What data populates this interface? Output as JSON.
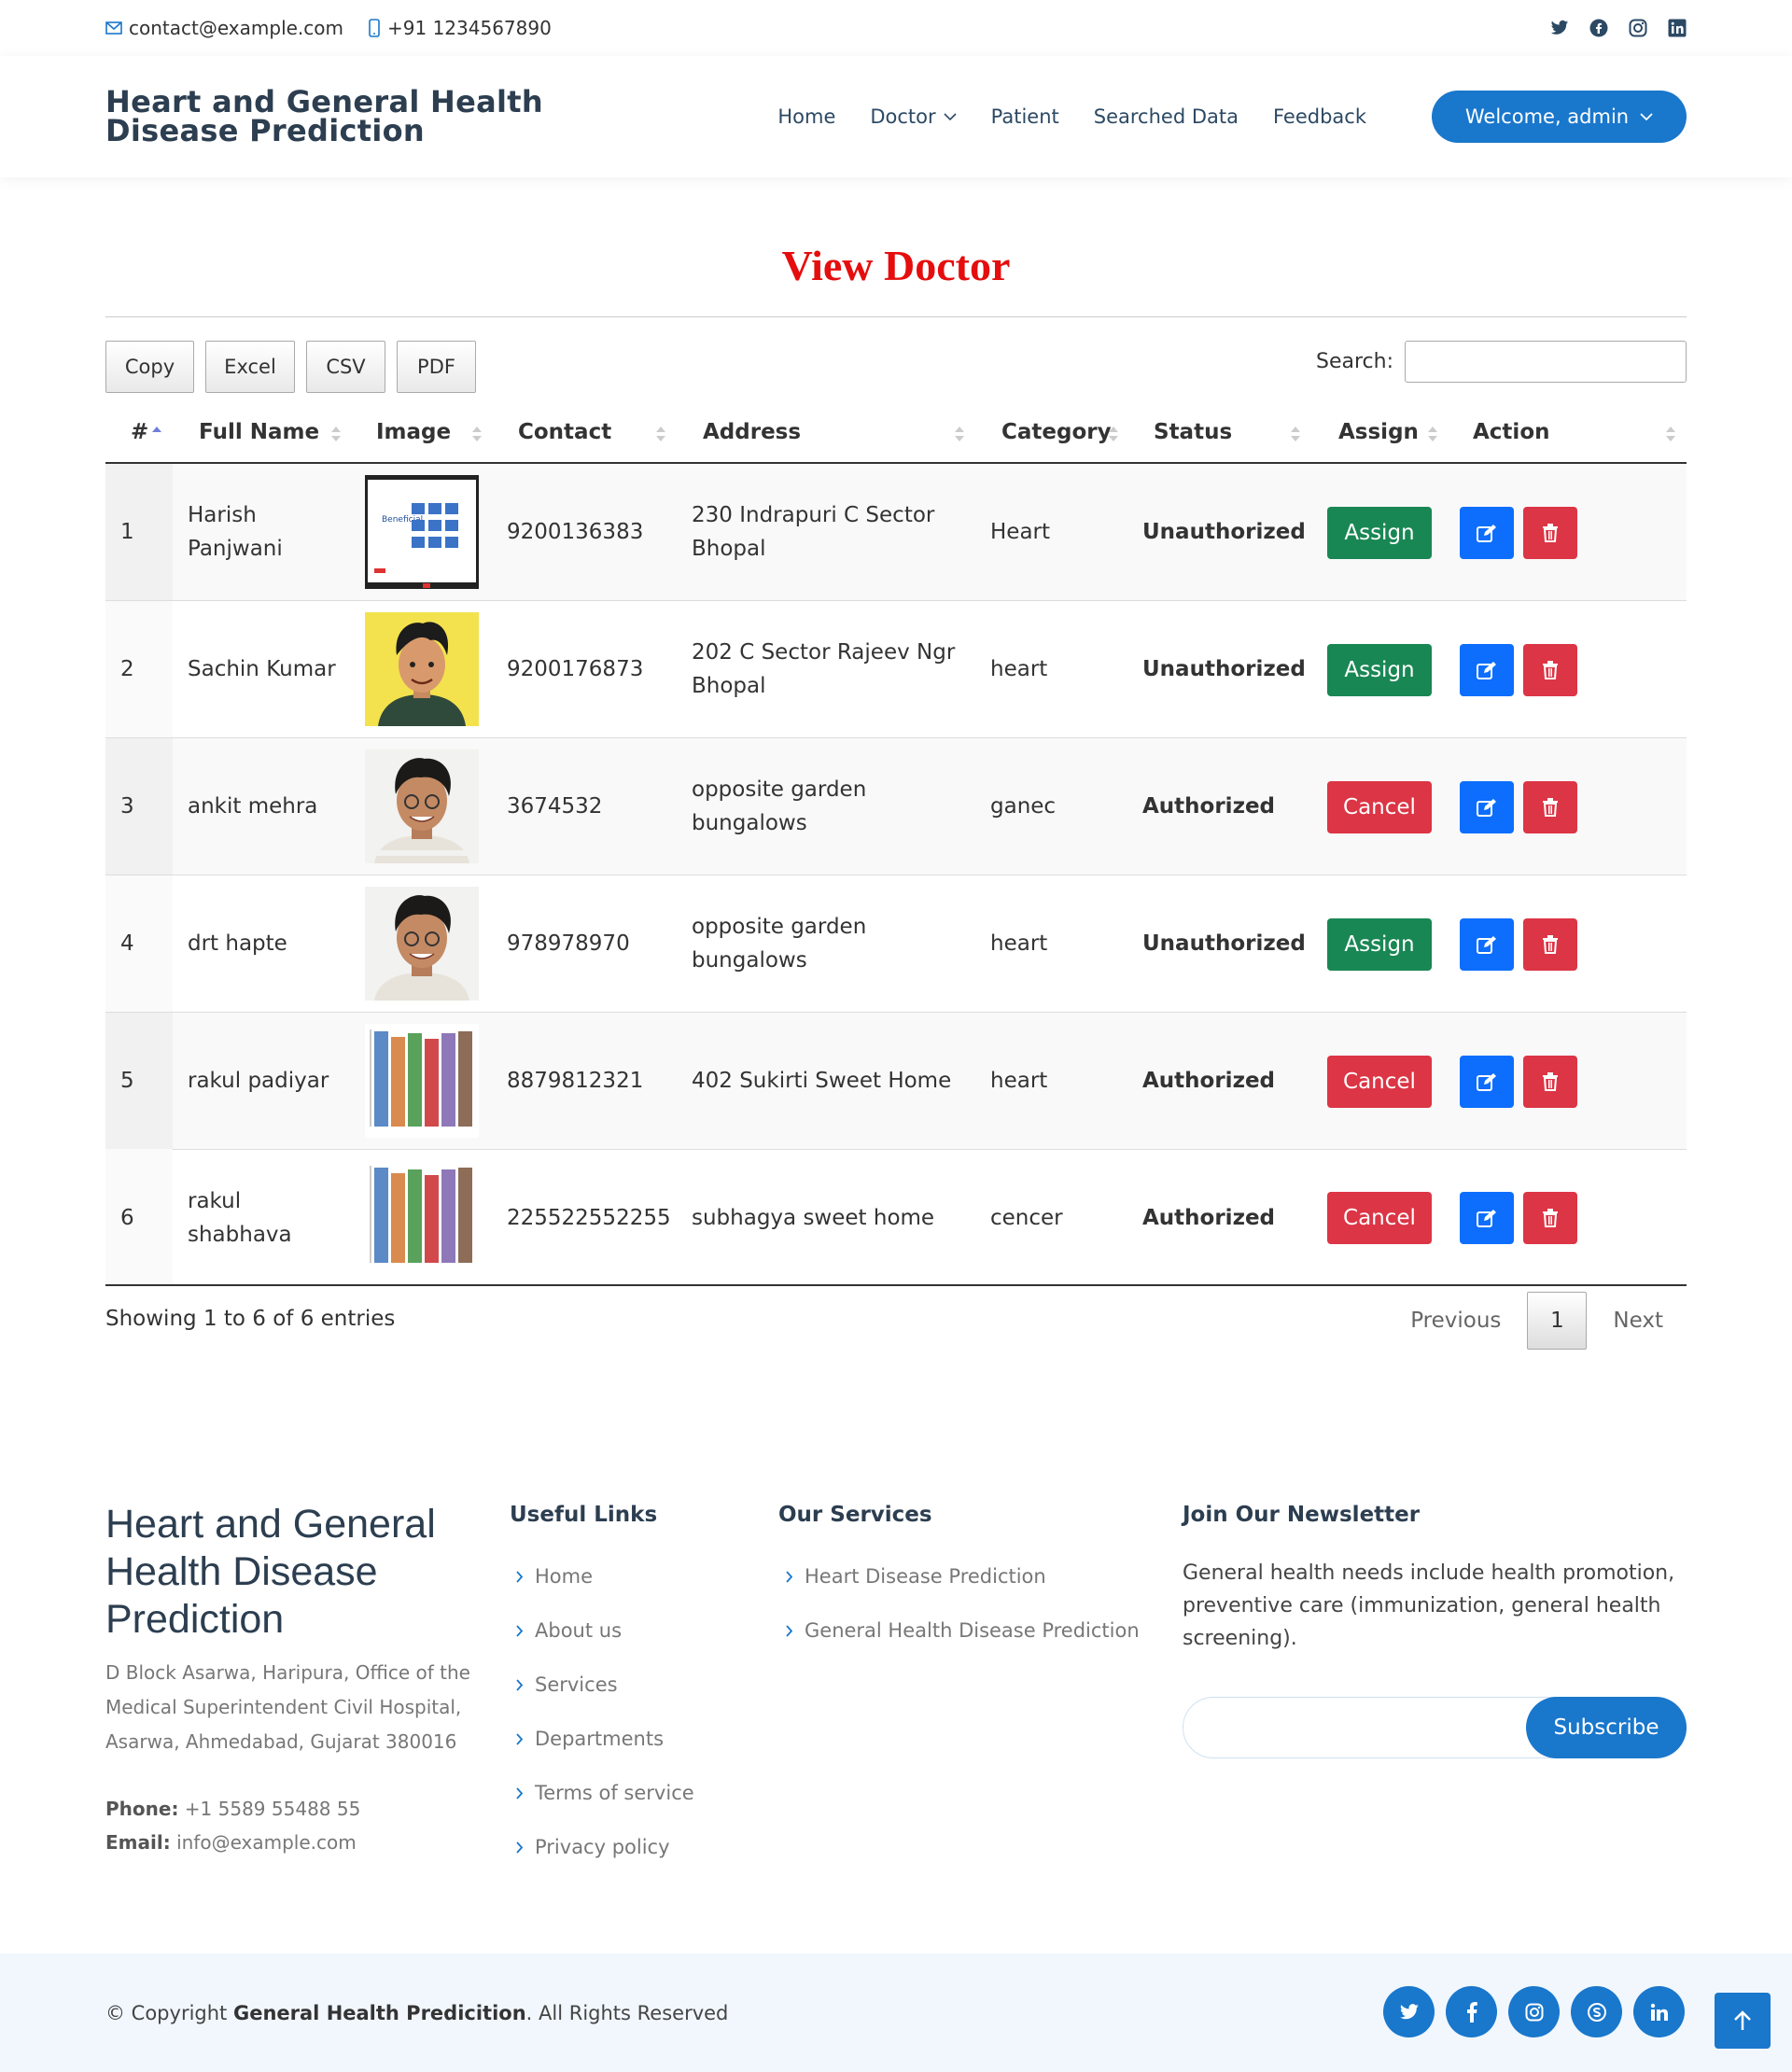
{
  "topbar": {
    "email": "contact@example.com",
    "phone": "+91 1234567890",
    "social_icons": [
      "twitter-icon",
      "facebook-icon",
      "instagram-icon",
      "linkedin-icon"
    ]
  },
  "header": {
    "logo": "Heart and General Health Disease Prediction",
    "nav": [
      "Home",
      "Doctor",
      "Patient",
      "Searched Data",
      "Feedback"
    ],
    "user_button": "Welcome, admin"
  },
  "page": {
    "title": "View Doctor"
  },
  "toolbar": {
    "buttons": [
      "Copy",
      "Excel",
      "CSV",
      "PDF"
    ],
    "search_label": "Search:",
    "search_value": ""
  },
  "table": {
    "columns": [
      "#",
      "Full Name",
      "Image",
      "Contact",
      "Address",
      "Category",
      "Status",
      "Assign",
      "Action"
    ],
    "rows": [
      {
        "no": "1",
        "name": "Harish Panjwani",
        "image": "document-thumbnail",
        "contact": "9200136383",
        "address": "230 Indrapuri C Sector Bhopal",
        "category": "Heart",
        "status": "Unauthorized",
        "assign": "Assign"
      },
      {
        "no": "2",
        "name": "Sachin Kumar",
        "image": "cartoon-avatar",
        "contact": "9200176873",
        "address": "202 C Sector Rajeev Ngr Bhopal",
        "category": "heart",
        "status": "Unauthorized",
        "assign": "Assign"
      },
      {
        "no": "3",
        "name": "ankit mehra",
        "image": "person-photo",
        "contact": "3674532",
        "address": "opposite garden bungalows",
        "category": "ganec",
        "status": "Authorized",
        "assign": "Cancel"
      },
      {
        "no": "4",
        "name": "drt hapte",
        "image": "person-photo",
        "contact": "978978970",
        "address": "opposite garden bungalows",
        "category": "heart",
        "status": "Unauthorized",
        "assign": "Assign"
      },
      {
        "no": "5",
        "name": "rakul padiyar",
        "image": "bar-chart-thumbnail",
        "contact": "8879812321",
        "address": "402 Sukirti Sweet Home",
        "category": "heart",
        "status": "Authorized",
        "assign": "Cancel"
      },
      {
        "no": "6",
        "name": "rakul shabhava",
        "image": "bar-chart-thumbnail",
        "contact": "225522552255",
        "address": "subhagya sweet home",
        "category": "cencer",
        "status": "Authorized",
        "assign": "Cancel"
      }
    ],
    "info": "Showing 1 to 6 of 6 entries",
    "pagination": {
      "previous": "Previous",
      "current": "1",
      "next": "Next"
    }
  },
  "footer": {
    "title": "Heart and General Health Disease Prediction",
    "address": "D Block Asarwa, Haripura, Office of the Medical Superintendent Civil Hospital, Asarwa, Ahmedabad, Gujarat 380016",
    "phone_label": "Phone:",
    "phone": "+1 5589 55488 55",
    "email_label": "Email:",
    "email": "info@example.com",
    "useful_links_title": "Useful Links",
    "useful_links": [
      "Home",
      "About us",
      "Services",
      "Departments",
      "Terms of service",
      "Privacy policy"
    ],
    "services_title": "Our Services",
    "services": [
      "Heart Disease Prediction",
      "General Health Disease Prediction"
    ],
    "newsletter_title": "Join Our Newsletter",
    "newsletter_text": "General health needs include health promotion, preventive care (immunization, general health screening).",
    "subscribe": "Subscribe",
    "copyright_prefix": "© Copyright",
    "copyright_brand": "General Health Predicition",
    "copyright_suffix": ". All Rights Reserved",
    "social_icons": [
      "twitter-icon",
      "facebook-icon",
      "instagram-icon",
      "skype-icon",
      "linkedin-icon"
    ]
  },
  "colors": {
    "primary": "#1977cc",
    "title_red": "#e50d0d",
    "assign_green": "#198754",
    "danger_red": "#dc3545",
    "edit_blue": "#0d6efd"
  }
}
